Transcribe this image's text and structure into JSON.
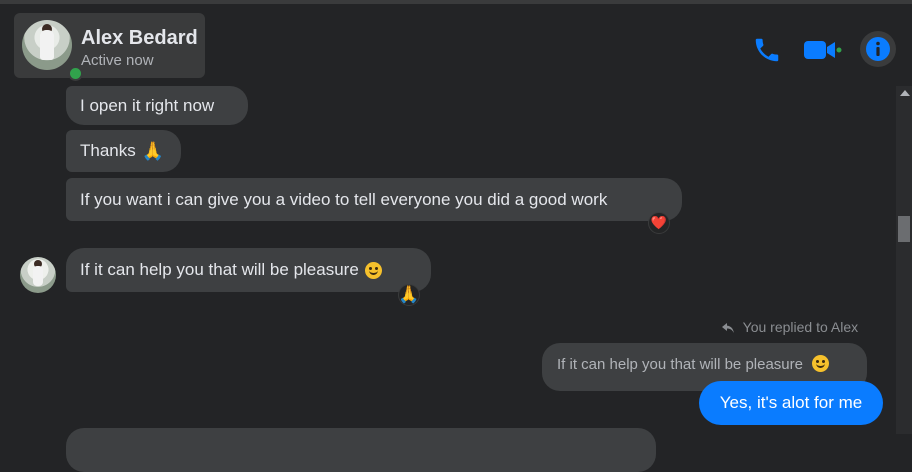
{
  "header": {
    "contact_name": "Alex Bedard",
    "contact_status": "Active now",
    "icons": [
      "phone-icon",
      "video-call-icon",
      "info-icon"
    ],
    "accent_color": "#0a7cff",
    "online_color": "#31a24c"
  },
  "messages": {
    "incoming": [
      {
        "text": "I open it right now"
      },
      {
        "text": "Thanks",
        "emoji": "🙏"
      },
      {
        "text": "If you want i can give you a video to tell everyone you did a good work",
        "reaction": "❤️"
      },
      {
        "text": "If it can help you that will be pleasure",
        "emoji": "smile",
        "reaction": "🙏"
      }
    ],
    "reply_context": {
      "label": "You replied to Alex",
      "quoted_text": "If it can help you that will be pleasure"
    },
    "outgoing": [
      {
        "text": "Yes, it's alot for me"
      }
    ]
  }
}
